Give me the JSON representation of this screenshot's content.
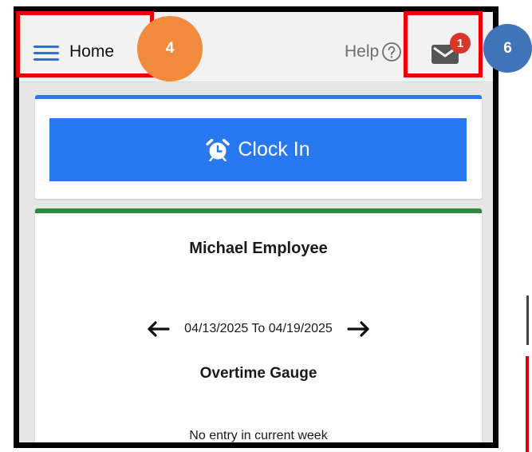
{
  "header": {
    "home_label": "Home",
    "help_label": "Help",
    "mail_badge_count": "1"
  },
  "clock_card": {
    "button_label": "Clock In"
  },
  "info_card": {
    "employee_name": "Michael Employee",
    "week_range": "04/13/2025 To 04/19/2025",
    "gauge_title": "Overtime Gauge",
    "empty_message": "No entry in current week"
  },
  "annotations": {
    "step_home": "4",
    "step_mail": "6"
  },
  "colors": {
    "primary_blue": "#2878f0",
    "card_green": "#2e8b3e",
    "badge_red": "#d9362b",
    "annotation_red": "#ef0000",
    "step_orange": "#f08a3c",
    "step_blue": "#3f74b8"
  }
}
